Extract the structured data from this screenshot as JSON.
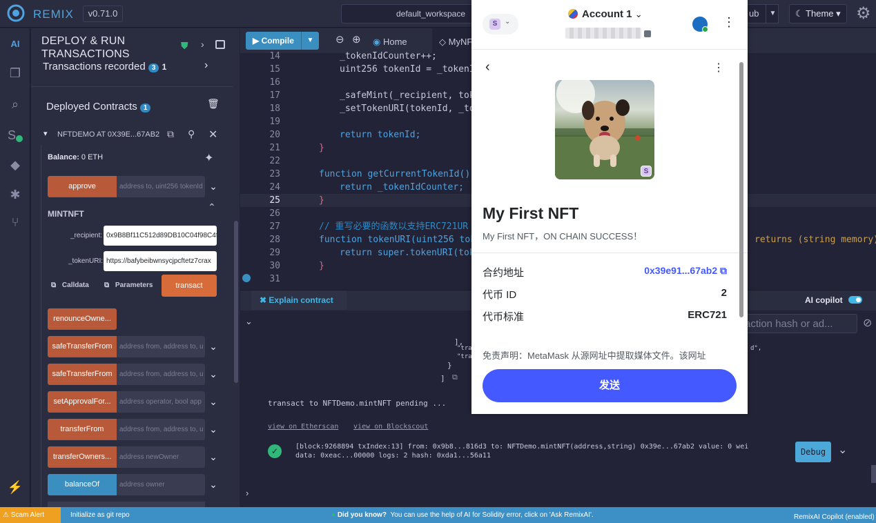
{
  "topbar": {
    "app_name": "REMIX",
    "version": "v0.71.0",
    "workspace": "default_workspace",
    "github_label": "ub",
    "theme_label": "Theme"
  },
  "side_panel": {
    "title_line1": "DEPLOY & RUN",
    "title_line2": "TRANSACTIONS",
    "tx_recorded_label": "Transactions recorded",
    "tx_recorded_badge": "3",
    "tx_recorded_count": "1",
    "deployed_label": "Deployed Contracts",
    "deployed_count": "1",
    "contract_name": "NFTDEMO AT 0X39E...67AB2 (I",
    "balance_label": "Balance:",
    "balance_value": "0 ETH",
    "approve": {
      "label": "approve",
      "placeholder": "address to, uint256 tokenId"
    },
    "mintnft": {
      "label": "MINTNFT",
      "recipient_label": "_recipient:",
      "recipient_value": "0x9B8Bf11C512d89DB10C04f98C4f",
      "tokenuri_label": "_tokenURI:",
      "tokenuri_value": "https://bafybeibwnsycjpcftetz7crax",
      "calldata": "Calldata",
      "parameters": "Parameters",
      "transact": "transact"
    },
    "functions": [
      {
        "label": "renounceOwne...",
        "placeholder": ""
      },
      {
        "label": "safeTransferFrom",
        "placeholder": "address from, address to, u"
      },
      {
        "label": "safeTransferFrom",
        "placeholder": "address from, address to, u"
      },
      {
        "label": "setApprovalFor...",
        "placeholder": "address operator, bool app"
      },
      {
        "label": "transferFrom",
        "placeholder": "address from, address to, u"
      },
      {
        "label": "transferOwners...",
        "placeholder": "address newOwner"
      },
      {
        "label": "balanceOf",
        "placeholder": "address owner"
      }
    ]
  },
  "editor": {
    "compile_label": "Compile",
    "tabs": [
      "Home",
      "MyNF"
    ],
    "lines": [
      {
        "n": "14",
        "text": "_tokenIdCounter++;"
      },
      {
        "n": "15",
        "text": "uint256 tokenId = _tokenI"
      },
      {
        "n": "16",
        "text": ""
      },
      {
        "n": "17",
        "text": "_safeMint(_recipient, tok"
      },
      {
        "n": "18",
        "text": "_setTokenURI(tokenId, _to"
      },
      {
        "n": "19",
        "text": ""
      },
      {
        "n": "20",
        "text": "return tokenId;"
      },
      {
        "n": "21",
        "text": "}"
      },
      {
        "n": "22",
        "text": ""
      },
      {
        "n": "23",
        "text": "function getCurrentTokenId()"
      },
      {
        "n": "24",
        "text": "return _tokenIdCounter;"
      },
      {
        "n": "25",
        "text": "}"
      },
      {
        "n": "26",
        "text": ""
      },
      {
        "n": "27",
        "text": "// 重写必要的函数以支持ERC721UR"
      },
      {
        "n": "28",
        "text": "function tokenURI(uint256 tok"
      },
      {
        "n": "29",
        "text": "return super.tokenURI(tok"
      },
      {
        "n": "30",
        "text": "}"
      },
      {
        "n": "31",
        "text": ""
      }
    ],
    "right_overflow": "returns (string memory)"
  },
  "terminal": {
    "explain_label": "Explain contract",
    "ai_copilot_label": "AI copilot",
    "search_placeholder": "action hash or ad...",
    "pending": "transact to NFTDemo.mintNFT pending ...",
    "etherscan": "view on Etherscan",
    "blockscout": "view on Blockscout",
    "tx_line1": "[block:9268894 txIndex:13] from: 0x9b8...816d3 to: NFTDemo.mintNFT(address,string) 0x39e...67ab2 value: 0 wei",
    "tx_line2": "data: 0xeac...00000 logs: 2 hash: 0xda1...56a11",
    "debug_label": "Debug",
    "json_fragment_1": "],",
    "json_fragment_2": "\"trans",
    "json_fragment_3": "\"trans",
    "json_fragment_4": "}",
    "json_fragment_5": "]",
    "json_suffix": "d\","
  },
  "statusbar": {
    "scam": "Scam Alert",
    "git": "Initialize as git repo",
    "dyk_label": "Did you know?",
    "dyk_text": "You can use the help of AI for Solidity error, click on 'Ask RemixAI'.",
    "copilot": "RemixAI Copilot (enabled)"
  },
  "metamask": {
    "network_letter": "S",
    "account": "Account 1",
    "nft_title": "My First NFT",
    "nft_desc": "My First NFT，ON CHAIN SUCCESS！",
    "contract_label": "合约地址",
    "contract_value": "0x39e91...67ab2",
    "token_id_label": "代币 ID",
    "token_id_value": "2",
    "standard_label": "代币标准",
    "standard_value": "ERC721",
    "disclaimer": "免责声明：MetaMask 从源网址中提取媒体文件。该网址",
    "send_label": "发送",
    "badge_letter": "S"
  },
  "colors": {
    "accent_blue": "#3b8ec0",
    "fn_orange": "#b85a3a",
    "metamask_blue": "#4459ff",
    "status_bar": "#3c90c5"
  }
}
